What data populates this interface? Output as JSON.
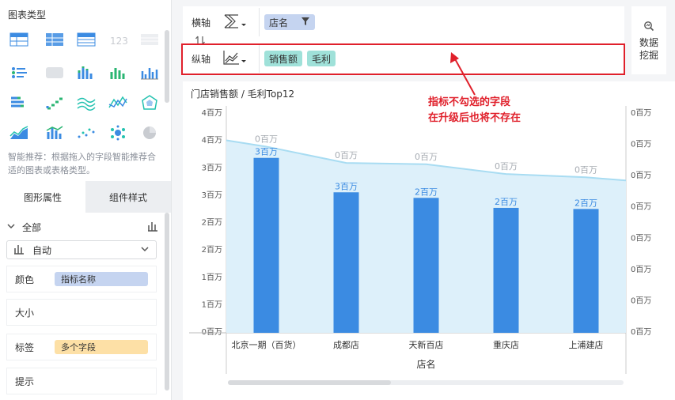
{
  "left_panel": {
    "chart_type_title": "图表类型",
    "hint": "智能推荐：根据拖入的字段智能推荐合适的图表或表格类型。",
    "tabs": [
      "图形属性",
      "组件样式"
    ],
    "all_label": "全部",
    "select_value": "自动",
    "props": [
      {
        "name": "颜色",
        "pill": "指标名称",
        "pill_color": "#c5d4f0"
      },
      {
        "name": "大小",
        "pill": "",
        "pill_color": ""
      },
      {
        "name": "标签",
        "pill": "多个字段",
        "pill_color": "#fde0a6"
      },
      {
        "name": "提示",
        "pill": "",
        "pill_color": ""
      }
    ]
  },
  "fields": {
    "x_axis_label": "横轴",
    "y_axis_label": "纵轴",
    "x_fields": [
      {
        "label": "店名",
        "color": "#c5d4f0",
        "filter_icon": "filter-icon"
      }
    ],
    "y_fields": [
      {
        "label": "销售额",
        "color": "#9fe1d9"
      },
      {
        "label": "毛利",
        "color": "#9fe1d9"
      }
    ]
  },
  "data_mining": {
    "label": "数据挖掘",
    "icon": "magnifier-icon"
  },
  "annotation": [
    "指标不勾选的字段",
    "在升级后也将不存在"
  ],
  "colors": {
    "bar": "#3b8be2",
    "area_fill": "#ddf0fa",
    "area_line": "#a8dcf2",
    "highlight": "#e0202b"
  },
  "chart_data": {
    "type": "bar",
    "title": "门店销售额 / 毛利Top12",
    "xlabel": "店名",
    "categories": [
      "北京一期（百货）",
      "成都店",
      "天新百店",
      "重庆店",
      "上浦建店"
    ],
    "left_ticks": [
      "4百万",
      "4百万",
      "3百万",
      "3百万",
      "2百万",
      "2百万",
      "1百万",
      "1百万",
      "0百万"
    ],
    "right_ticks": [
      "0百万",
      "0百万",
      "0百万",
      "0百万",
      "0百万",
      "0百万",
      "0百万",
      "0百万"
    ],
    "ylim": [
      0,
      4
    ],
    "series": [
      {
        "name": "销售额",
        "kind": "bar",
        "values": [
          3.15,
          2.53,
          2.43,
          2.25,
          2.23
        ],
        "labels": [
          "3百万",
          "3百万",
          "2百万",
          "2百万",
          "2百万"
        ]
      },
      {
        "name": "毛利",
        "kind": "area",
        "values": [
          0.285,
          0.26,
          0.258,
          0.243,
          0.238
        ],
        "labels": [
          "0百万",
          "0百万",
          "0百万",
          "0百万",
          "0百万"
        ],
        "ylim": [
          0,
          0.34
        ]
      }
    ]
  }
}
